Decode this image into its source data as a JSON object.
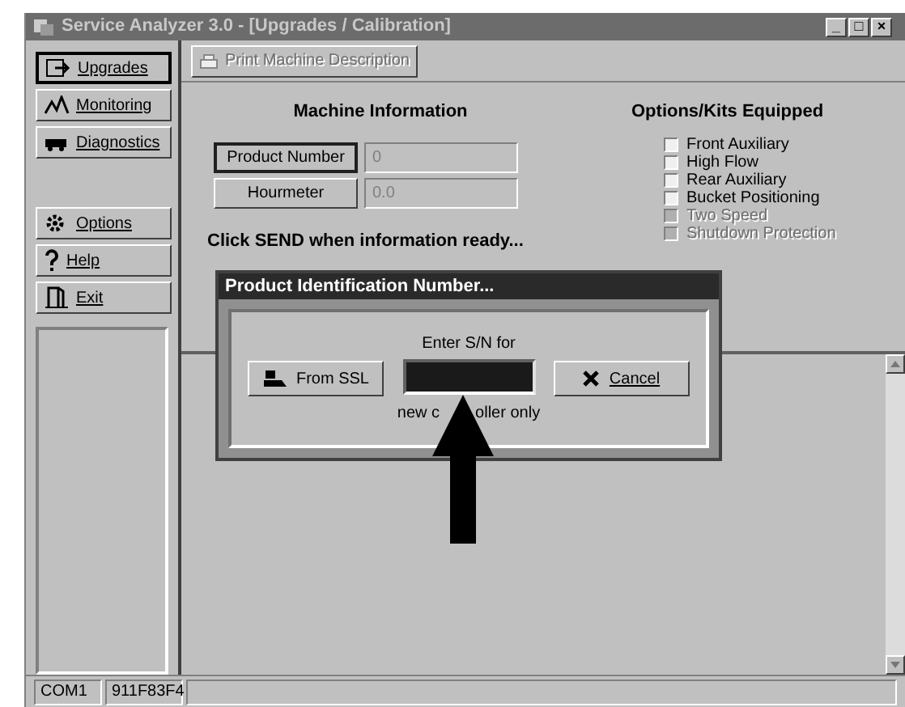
{
  "window": {
    "title": "Service Analyzer 3.0 - [Upgrades / Calibration]",
    "controls": [
      "_",
      "□",
      "×"
    ]
  },
  "sidebar": {
    "groups": [
      {
        "items": [
          {
            "label": "Upgrades",
            "kind": "upgrade",
            "selected": true
          },
          {
            "label": "Monitoring",
            "kind": "monitor",
            "selected": false
          },
          {
            "label": "Diagnostics",
            "kind": "diagnostics",
            "selected": false
          }
        ]
      },
      {
        "items": [
          {
            "label": "Options",
            "kind": "options",
            "selected": false
          },
          {
            "label": "Help",
            "kind": "help",
            "selected": false
          },
          {
            "label": "Exit",
            "kind": "exit",
            "selected": false
          }
        ]
      }
    ]
  },
  "toolbar": {
    "print_button": {
      "label": "Print Machine Description",
      "disabled": true
    }
  },
  "machine_information": {
    "title": "Machine Information",
    "fields": [
      {
        "button": "Product Number",
        "value": "0",
        "focused": true
      },
      {
        "button": "Hourmeter",
        "value": "0.0",
        "focused": false
      }
    ]
  },
  "options_kits": {
    "title": "Options/Kits Equipped",
    "items": [
      {
        "label": "Front Auxiliary",
        "checked": false,
        "disabled": false
      },
      {
        "label": "High Flow",
        "checked": false,
        "disabled": false
      },
      {
        "label": "Rear Auxiliary",
        "checked": false,
        "disabled": false
      },
      {
        "label": "Bucket Positioning",
        "checked": false,
        "disabled": false
      },
      {
        "label": "Two Speed",
        "checked": false,
        "disabled": true
      },
      {
        "label": "Shutdown Protection",
        "checked": false,
        "disabled": true
      }
    ]
  },
  "prompt": "Click SEND when information ready...",
  "dialog": {
    "title": "Product Identification Number...",
    "from_button": "From SSL",
    "field_label": "Enter S/N for",
    "caption_parts": [
      "new c",
      "oller only"
    ],
    "cancel_button": "Cancel"
  },
  "status_bar": [
    "COM1",
    "911F83F4"
  ]
}
